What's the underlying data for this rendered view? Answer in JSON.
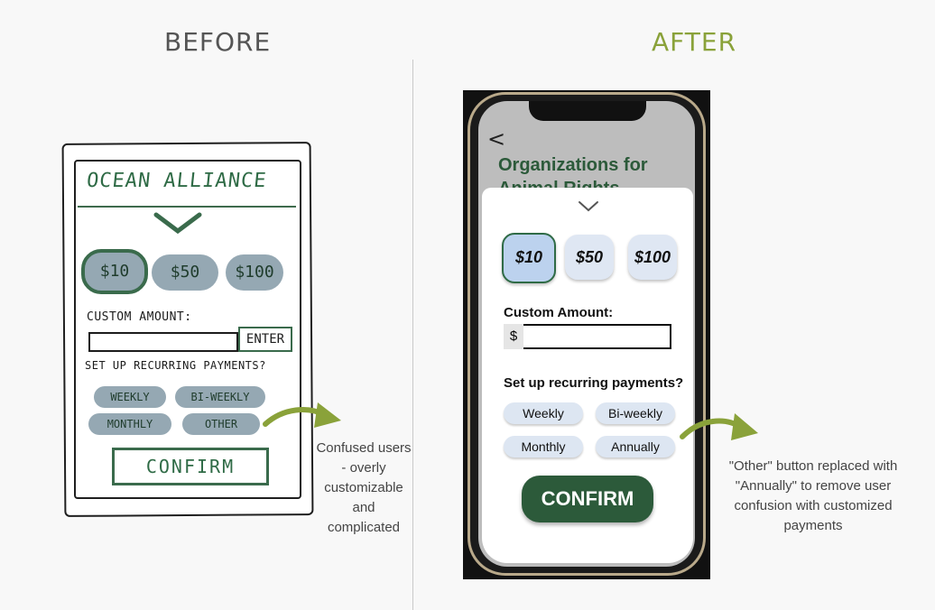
{
  "headings": {
    "before": "BEFORE",
    "after": "AFTER"
  },
  "sketch": {
    "title": "OCEAN ALLIANCE",
    "amounts": [
      "$10",
      "$50",
      "$100"
    ],
    "custom_amount_label": "CUSTOM AMOUNT:",
    "enter_label": "ENTER",
    "recurring_label": "SET UP RECURRING PAYMENTS?",
    "frequencies": [
      "WEEKLY",
      "BI-WEEKLY",
      "MONTHLY",
      "OTHER"
    ],
    "confirm_label": "CONFIRM"
  },
  "notes": {
    "before": "Confused users - overly customizable and complicated",
    "after": "\"Other\" button replaced with \"Annually\" to remove user confusion with customized payments"
  },
  "phone": {
    "title_line1": "Organizations for",
    "title_line2": "Animal Rights",
    "amounts": [
      "$10",
      "$50",
      "$100"
    ],
    "custom_amount_label": "Custom Amount:",
    "currency_symbol": "$",
    "custom_amount_value": "",
    "recurring_label": "Set up recurring payments?",
    "frequencies": [
      "Weekly",
      "Bi-weekly",
      "Monthly",
      "Annually"
    ],
    "confirm_label": "CONFIRM"
  },
  "colors": {
    "after_heading": "#8aa23a",
    "brand_green": "#2c5a3a",
    "arrow_green": "#8aa23a",
    "selected_amount": "#bcd2ee"
  }
}
